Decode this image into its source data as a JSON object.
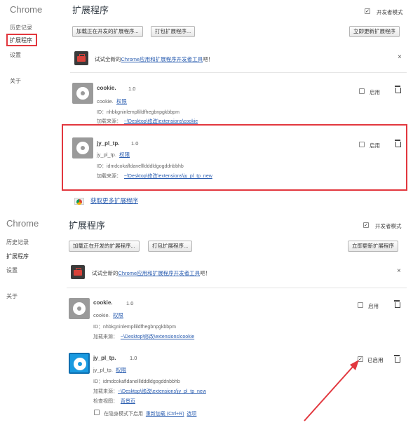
{
  "panels": [
    {
      "brand": "Chrome",
      "nav": [
        "历史记录",
        "扩展程序",
        "设置",
        "关于"
      ],
      "title": "扩展程序",
      "dev_mode_label": "开发者模式",
      "dev_mode_checked": true,
      "buttons": {
        "load": "加载正在开发的扩展程序...",
        "pack": "打包扩展程序...",
        "update": "立即更新扩展程序"
      },
      "promo": {
        "prefix": "试试全新的",
        "link": "Chrome应用和扩展程序开发者工具",
        "suffix": "吧！",
        "close": "×"
      },
      "extensions": [
        {
          "name": "cookie.",
          "version": "1.0",
          "desc": "cookie.",
          "perm_link": "权限",
          "id_label": "ID：",
          "id": "nhbkgninlempllildfhegbnpgkbbpm",
          "source_label": "加载来源：",
          "source": "~\\Desktop\\修改\\extensions\\cookie",
          "enable_label": "启用",
          "enabled": false
        },
        {
          "name": "jy_pl_tp.",
          "version": "1.0",
          "desc": "jy_pl_tp.",
          "perm_link": "权限",
          "id_label": "ID：",
          "id": "idmdcokafldanellldddldgogddnbbhb",
          "source_label": "加载来源：",
          "source": "~\\Desktop\\修改\\extensions\\jy_pl_tp_new",
          "enable_label": "启用",
          "enabled": false
        }
      ],
      "store_link": "获取更多扩展程序"
    },
    {
      "brand": "Chrome",
      "nav": [
        "历史记录",
        "扩展程序",
        "设置",
        "关于"
      ],
      "title": "扩展程序",
      "dev_mode_label": "开发者模式",
      "dev_mode_checked": true,
      "buttons": {
        "load": "加载正在开发的扩展程序...",
        "pack": "打包扩展程序...",
        "update": "立即更新扩展程序"
      },
      "promo": {
        "prefix": "试试全新的",
        "link": "Chrome应用和扩展程序开发者工具",
        "suffix": "吧！",
        "close": "×"
      },
      "extensions": [
        {
          "name": "cookie.",
          "version": "1.0",
          "desc": "cookie.",
          "perm_link": "权限",
          "id_label": "ID：",
          "id": "nhbkgninlempllildfhegbnpgkbbpm",
          "source_label": "加载来源：",
          "source": "~\\Desktop\\修改\\extensions\\cookie",
          "enable_label": "启用",
          "enabled": false
        },
        {
          "name": "jy_pl_tp.",
          "version": "1.0",
          "desc": "jy_pl_tp.",
          "perm_link": "权限",
          "id_label": "ID：",
          "id": "idmdcokafldanellldddldgogddnbbhb",
          "source_label": "加载来源：",
          "source": "~\\Desktop\\修改\\extensions\\jy_pl_tp_new",
          "inspect_label": "检查视图：",
          "inspect_link": "背景页",
          "incognito_label": "在隐身模式下启用",
          "reload_link": "重新加载 (Ctrl+R)",
          "options_link": "选项",
          "enable_label": "已启用",
          "enabled": true
        }
      ]
    }
  ],
  "colors": {
    "highlight_border": "#e2373e",
    "link": "#2a5db0",
    "active_icon": "#1a9ae0"
  }
}
